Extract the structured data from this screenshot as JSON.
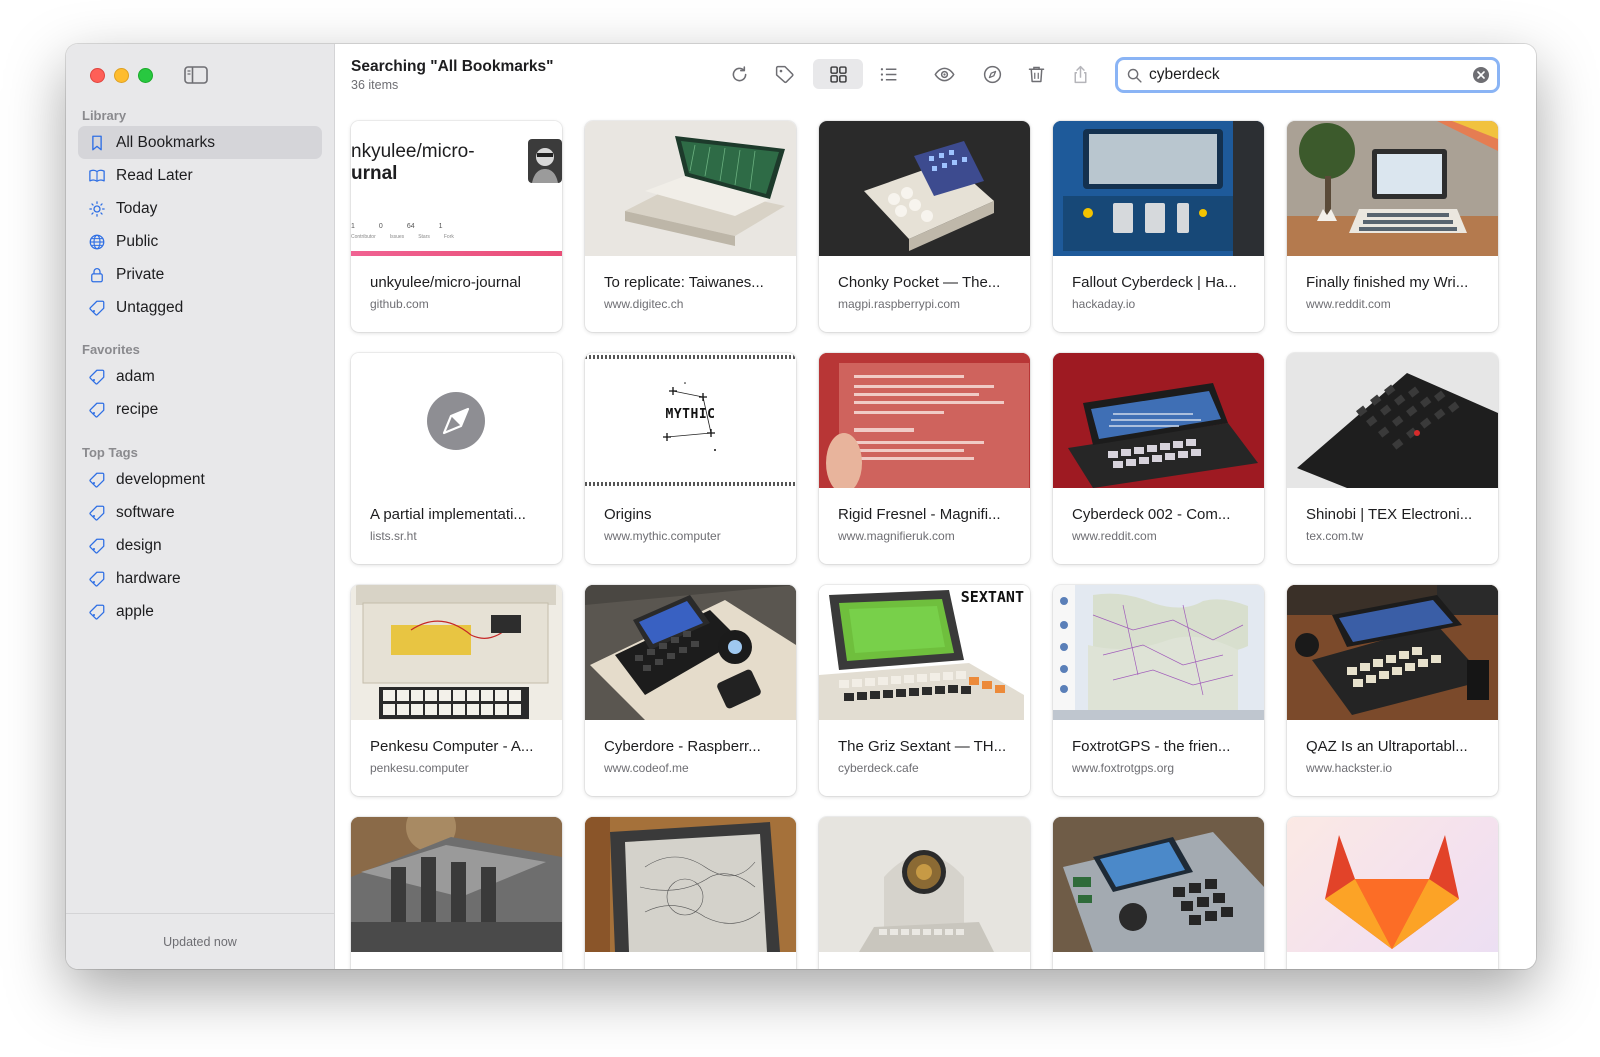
{
  "sidebar": {
    "library_heading": "Library",
    "library": [
      {
        "label": "All Bookmarks",
        "icon": "bookmark-icon",
        "active": true
      },
      {
        "label": "Read Later",
        "icon": "book-icon"
      },
      {
        "label": "Today",
        "icon": "sun-icon"
      },
      {
        "label": "Public",
        "icon": "globe-icon"
      },
      {
        "label": "Private",
        "icon": "lock-icon"
      },
      {
        "label": "Untagged",
        "icon": "tag-icon"
      }
    ],
    "favorites_heading": "Favorites",
    "favorites": [
      {
        "label": "adam",
        "icon": "tag-icon"
      },
      {
        "label": "recipe",
        "icon": "tag-icon"
      }
    ],
    "tags_heading": "Top Tags",
    "tags": [
      {
        "label": "development",
        "icon": "tag-icon"
      },
      {
        "label": "software",
        "icon": "tag-icon"
      },
      {
        "label": "design",
        "icon": "tag-icon"
      },
      {
        "label": "hardware",
        "icon": "tag-icon"
      },
      {
        "label": "apple",
        "icon": "tag-icon"
      }
    ],
    "footer": "Updated now"
  },
  "toolbar": {
    "title": "Searching \"All Bookmarks\"",
    "count": "36 items",
    "search_value": "cyberdeck"
  },
  "colors": {
    "accent": "#2f6fe4",
    "search_focus": "#8ab4f5",
    "sidebar_bg": "#e8e8ea"
  },
  "cards": [
    {
      "title": "unkyulee/micro-journal",
      "domain": "github.com"
    },
    {
      "title": "To replicate: Taiwanes...",
      "domain": "www.digitec.ch"
    },
    {
      "title": "Chonky Pocket — The...",
      "domain": "magpi.raspberrypi.com"
    },
    {
      "title": "Fallout Cyberdeck | Ha...",
      "domain": "hackaday.io"
    },
    {
      "title": "Finally finished my Wri...",
      "domain": "www.reddit.com"
    },
    {
      "title": "A partial implementati...",
      "domain": "lists.sr.ht"
    },
    {
      "title": "Origins",
      "domain": "www.mythic.computer"
    },
    {
      "title": "Rigid Fresnel - Magnifi...",
      "domain": "www.magnifieruk.com"
    },
    {
      "title": "Cyberdeck 002 - Com...",
      "domain": "www.reddit.com"
    },
    {
      "title": "Shinobi | TEX Electroni...",
      "domain": "tex.com.tw"
    },
    {
      "title": "Penkesu Computer - A...",
      "domain": "penkesu.computer"
    },
    {
      "title": "Cyberdore - Raspberr...",
      "domain": "www.codeof.me"
    },
    {
      "title": "The Griz Sextant — TH...",
      "domain": "cyberdeck.cafe"
    },
    {
      "title": "FoxtrotGPS - the frien...",
      "domain": "www.foxtrotgps.org"
    },
    {
      "title": "QAZ Is an Ultraportabl...",
      "domain": "www.hackster.io"
    }
  ],
  "thumb_text": {
    "repo_line1": "nkyulee/micro-",
    "repo_line2": "urnal",
    "repo_stats": [
      "1",
      "0",
      "64",
      "1"
    ],
    "repo_stat_labels": [
      "Contributor",
      "Issues",
      "Stars",
      "Fork"
    ],
    "mythic": "MYTHIC",
    "sextant": "SEXTANT"
  }
}
